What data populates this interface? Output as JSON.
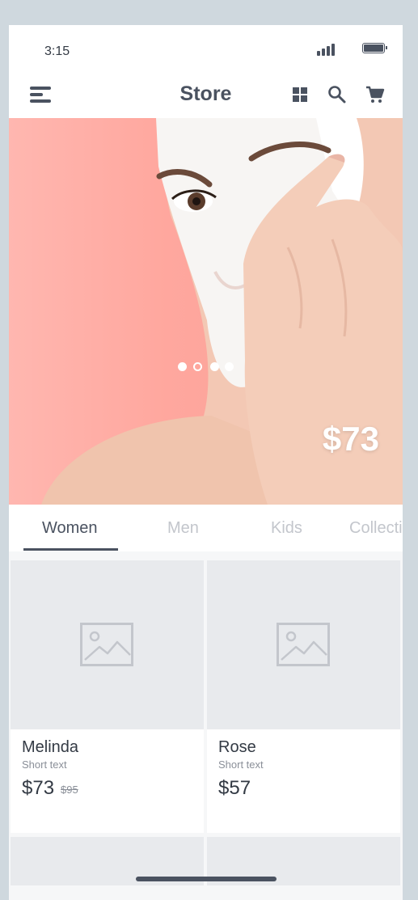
{
  "status_bar": {
    "time": "3:15",
    "signal_icon": "cellular-signal-icon",
    "battery_icon": "battery-icon"
  },
  "app_bar": {
    "title": "Store",
    "menu_icon": "hamburger-menu-icon",
    "actions": [
      "grid-view-icon",
      "search-icon",
      "shopping-cart-icon"
    ]
  },
  "hero": {
    "price": "$73",
    "carousel": {
      "count": 4,
      "active_index": 1
    }
  },
  "tabs": {
    "items": [
      {
        "label": "Women",
        "active": true
      },
      {
        "label": "Men",
        "active": false
      },
      {
        "label": "Kids",
        "active": false
      },
      {
        "label": "Collecti",
        "active": false
      }
    ]
  },
  "products": [
    {
      "name": "Melinda",
      "subtitle": "Short text",
      "price": "$73",
      "old_price": "$95",
      "image_icon": "image-placeholder-icon"
    },
    {
      "name": "Rose",
      "subtitle": "Short text",
      "price": "$57",
      "old_price": "",
      "image_icon": "image-placeholder-icon"
    }
  ],
  "colors": {
    "primary_text": "#4a5260",
    "inactive_tab": "#c3c6cc",
    "placeholder_bg": "#e8eaed",
    "hero_bg": "#ffa79e",
    "page_bg": "#cfd8de"
  }
}
